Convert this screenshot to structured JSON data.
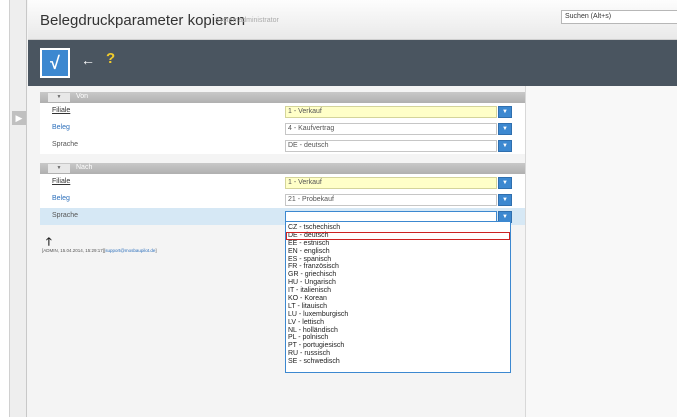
{
  "header": {
    "title": "Belegdruckparameter kopieren",
    "subtitle": "Systemadministrator",
    "search_placeholder": "Suchen (Alt+s)"
  },
  "toolbar": {
    "ok_glyph": "√",
    "back_glyph": "←",
    "help_glyph": "?"
  },
  "section_von": {
    "title": "Von",
    "rows": [
      {
        "label": "Filiale",
        "value": "1 - Verkauf"
      },
      {
        "label": "Beleg",
        "value": "4 - Kaufvertrag"
      },
      {
        "label": "Sprache",
        "value": "DE - deutsch"
      }
    ]
  },
  "section_nach": {
    "title": "Nach",
    "rows": [
      {
        "label": "Filiale",
        "value": "1 - Verkauf"
      },
      {
        "label": "Beleg",
        "value": "21 - Probekauf"
      },
      {
        "label": "Sprache",
        "value": ""
      }
    ]
  },
  "footer": {
    "audit_prefix": "[ADMIN, 15.04.2014, 15:29:17][",
    "audit_mail": "support@mosbaupilot.de",
    "audit_suffix": "]"
  },
  "dropdown": {
    "selected_index": 1,
    "options": [
      "CZ - tschechisch",
      "DE - deutsch",
      "EE - estnisch",
      "EN - englisch",
      "ES - spanisch",
      "FR - französisch",
      "GR - griechisch",
      "HU - Ungarisch",
      "IT - italienisch",
      "KO - Korean",
      "LT - litauisch",
      "LU - luxemburgisch",
      "LV - lettisch",
      "NL - holländisch",
      "PL - polnisch",
      "PT - portugiesisch",
      "RU - russisch",
      "SE - schwedisch"
    ]
  },
  "colors": {
    "accent": "#3c88d0",
    "toolbar": "#4a5560",
    "required_field": "#ffffc8",
    "selection_outline": "#cc2222"
  }
}
